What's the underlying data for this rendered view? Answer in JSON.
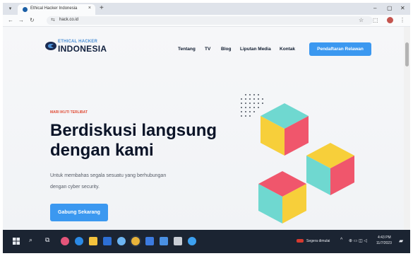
{
  "browser": {
    "tab_title": "Ethical Hacker Indonesia",
    "tab_close": "×",
    "new_tab": "+",
    "url": "hack.co.id",
    "minimize": "–",
    "maximize": "▢",
    "close": "✕"
  },
  "site": {
    "logo_small": "ETHICAL HACKER",
    "logo_big": "INDONESIA",
    "nav": [
      "Tentang",
      "TV",
      "Blog",
      "Liputan Media",
      "Kontak"
    ],
    "cta": "Pendaftaran Relawan"
  },
  "hero": {
    "eyebrow": "MARI IKUTI TERLIBAT",
    "headline_line1": "Berdiskusi langsung",
    "headline_line2": "dengan kami",
    "desc_line1": "Untuk membahas segala sesuatu yang berhubungan",
    "desc_line2": "dengan cyber security.",
    "button": "Gabung Sekarang"
  },
  "taskbar": {
    "weather": "Segera dimulai",
    "time": "4:43 PM",
    "date": "11/7/2023"
  },
  "colors": {
    "accent": "#3b98f0",
    "cube_teal": "#6fd8d0",
    "cube_yellow": "#f7cf3a",
    "cube_pink": "#f0566c",
    "taskbar": "#1b2432"
  }
}
